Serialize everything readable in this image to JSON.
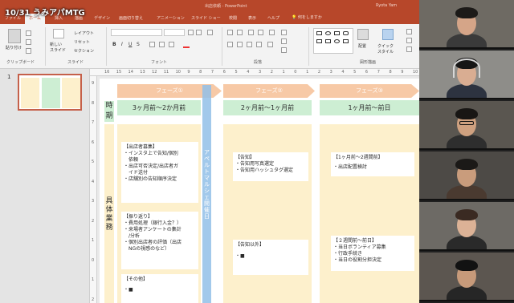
{
  "meeting_title": "10/31 うみアパMTG",
  "window": {
    "title": "出店依頼 - PowerPoint",
    "user": "Ryota Yam"
  },
  "ribbon_tabs": [
    "ファイル",
    "ホーム",
    "挿入",
    "描画",
    "デザイン",
    "画面切り替え",
    "アニメーション",
    "スライド ショー",
    "校閲",
    "表示",
    "ヘルプ"
  ],
  "tell_me": "何をしますか",
  "ribbon": {
    "paste": "貼り付け",
    "new_slide": "新しい\nスライド",
    "layout": "レイアウト",
    "reset": "リセット",
    "section": "セクション",
    "arrange": "配置",
    "quick_styles": "クイック\nスタイル",
    "groups": {
      "clipboard": "クリップボード",
      "slides": "スライド",
      "font": "フォント",
      "paragraph": "段落",
      "drawing": "図形描画"
    }
  },
  "thumbnail": {
    "slide_number": "1"
  },
  "ruler_top": [
    "16",
    "15",
    "14",
    "13",
    "12",
    "11",
    "10",
    "9",
    "8",
    "7",
    "6",
    "5",
    "4",
    "3",
    "2",
    "1",
    "0",
    "1",
    "2",
    "3",
    "4",
    "5",
    "6",
    "7",
    "8",
    "9",
    "10"
  ],
  "ruler_left": [
    "9",
    "8",
    "7",
    "6",
    "5",
    "4",
    "3",
    "2",
    "1",
    "0",
    "1",
    "2"
  ],
  "slide": {
    "row_label_time": "時期",
    "row_label_tasks": "具体業務",
    "blue_bar_text": "アペルトマルシェ開催日",
    "phases": [
      {
        "name": "フェーズ①",
        "period": "3ヶ月前〜2か月前"
      },
      {
        "name": "フェーズ②",
        "period": "2ヶ月前〜1ヶ月前"
      },
      {
        "name": "フェーズ③",
        "period": "1ヶ月前〜前日"
      }
    ],
    "boxes": {
      "p1_a": {
        "header": "【出店者募集】",
        "lines": [
          "・インスタ上で告知/個別",
          "　依頼",
          "・出店可否決定/出店者ガ",
          "　イド送付",
          "・店舗別の告知順序決定"
        ]
      },
      "p1_b": {
        "header": "【振り返り】",
        "lines": [
          "・費用処理（銀行入金？）",
          "・来場者アンケートの集計",
          "　/分析",
          "・個別出店者の評価（出店",
          "　NGの視感のなど）"
        ]
      },
      "p1_c": {
        "header": "【その他】",
        "lines": [
          "・■"
        ]
      },
      "p2_a": {
        "header": "【告知】",
        "lines": [
          "・告知用写真選定",
          "・告知用ハッシュタグ選定"
        ]
      },
      "p2_b": {
        "header": "【告知以外】",
        "lines": [
          "・■"
        ]
      },
      "p3_a": {
        "header": "【1ヶ月前〜2週間前】",
        "lines": [
          "・出店配置検討"
        ]
      },
      "p3_b": {
        "header": "【２週間前〜前日】",
        "lines": [
          "・当日ボランティア募集",
          "・行政手続き",
          "・当日の役割分担決定"
        ]
      }
    }
  },
  "colors": {
    "ppt_red": "#b7472a",
    "phase_orange": "#f7c9a6",
    "period_green": "#cdeed3",
    "task_cream": "#fdf0cc",
    "event_blue": "#92c0e8"
  },
  "participants": [
    {
      "bg": "#6e6a63",
      "skin": "#d5a588",
      "shirt": "#3a3a3a",
      "hair": "#1c1a18"
    },
    {
      "bg": "#8e8d89",
      "skin": "#d9ad92",
      "shirt": "#2d3340",
      "hair": "#161616",
      "headset": true
    },
    {
      "bg": "#5a5650",
      "skin": "#cfa180",
      "shirt": "#2e2e2e",
      "hair": "#181614",
      "glasses": true
    },
    {
      "bg": "#4d4a46",
      "skin": "#c99c7c",
      "shirt": "#4a3a30",
      "hair": "#1b1917"
    },
    {
      "bg": "#6d6a65",
      "skin": "#dcb296",
      "shirt": "#2a2a2a",
      "hair": "#3a2a22"
    },
    {
      "bg": "#5c5650",
      "skin": "#c79a7a",
      "shirt": "#262626",
      "hair": "#121212"
    }
  ]
}
